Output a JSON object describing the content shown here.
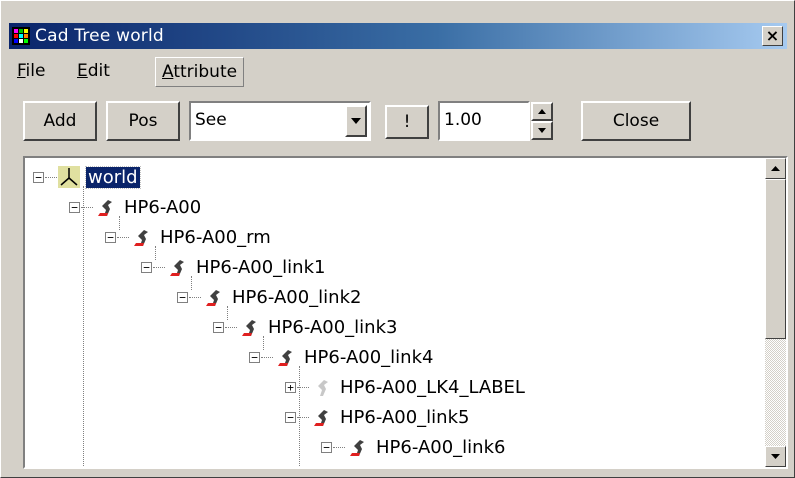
{
  "window": {
    "title": "Cad Tree world",
    "close_glyph": "×"
  },
  "menu": {
    "file": "ile",
    "file_mn": "F",
    "edit": "dit",
    "edit_mn": "E",
    "attribute": "ttribute",
    "attribute_mn": "A"
  },
  "toolbar": {
    "add": "Add",
    "pos": "Pos",
    "mode_selected": "See",
    "bang": "!",
    "scale_value": "1.00",
    "close": "Close"
  },
  "tree": {
    "nodes": [
      {
        "label": "world",
        "icon": "axis-frame-icon",
        "expander": "−",
        "selected": true
      },
      {
        "label": "HP6-A00",
        "icon": "robot-arm-icon",
        "expander": "−"
      },
      {
        "label": "HP6-A00_rm",
        "icon": "robot-arm-icon",
        "expander": "−"
      },
      {
        "label": "HP6-A00_link1",
        "icon": "robot-arm-icon",
        "expander": "−"
      },
      {
        "label": "HP6-A00_link2",
        "icon": "robot-arm-icon",
        "expander": "−"
      },
      {
        "label": "HP6-A00_link3",
        "icon": "robot-arm-icon",
        "expander": "−"
      },
      {
        "label": "HP6-A00_link4",
        "icon": "robot-arm-icon",
        "expander": "−"
      },
      {
        "label": "HP6-A00_LK4_LABEL",
        "icon": "robot-arm-grey-icon",
        "expander": "+"
      },
      {
        "label": "HP6-A00_link5",
        "icon": "robot-arm-icon",
        "expander": "−"
      },
      {
        "label": "HP6-A00_link6",
        "icon": "robot-arm-icon",
        "expander": "−"
      }
    ]
  },
  "colors": {
    "title_start": "#0a246a",
    "title_end": "#a6caf0",
    "selection": "#0a246a",
    "face": "#d4d0c8"
  }
}
